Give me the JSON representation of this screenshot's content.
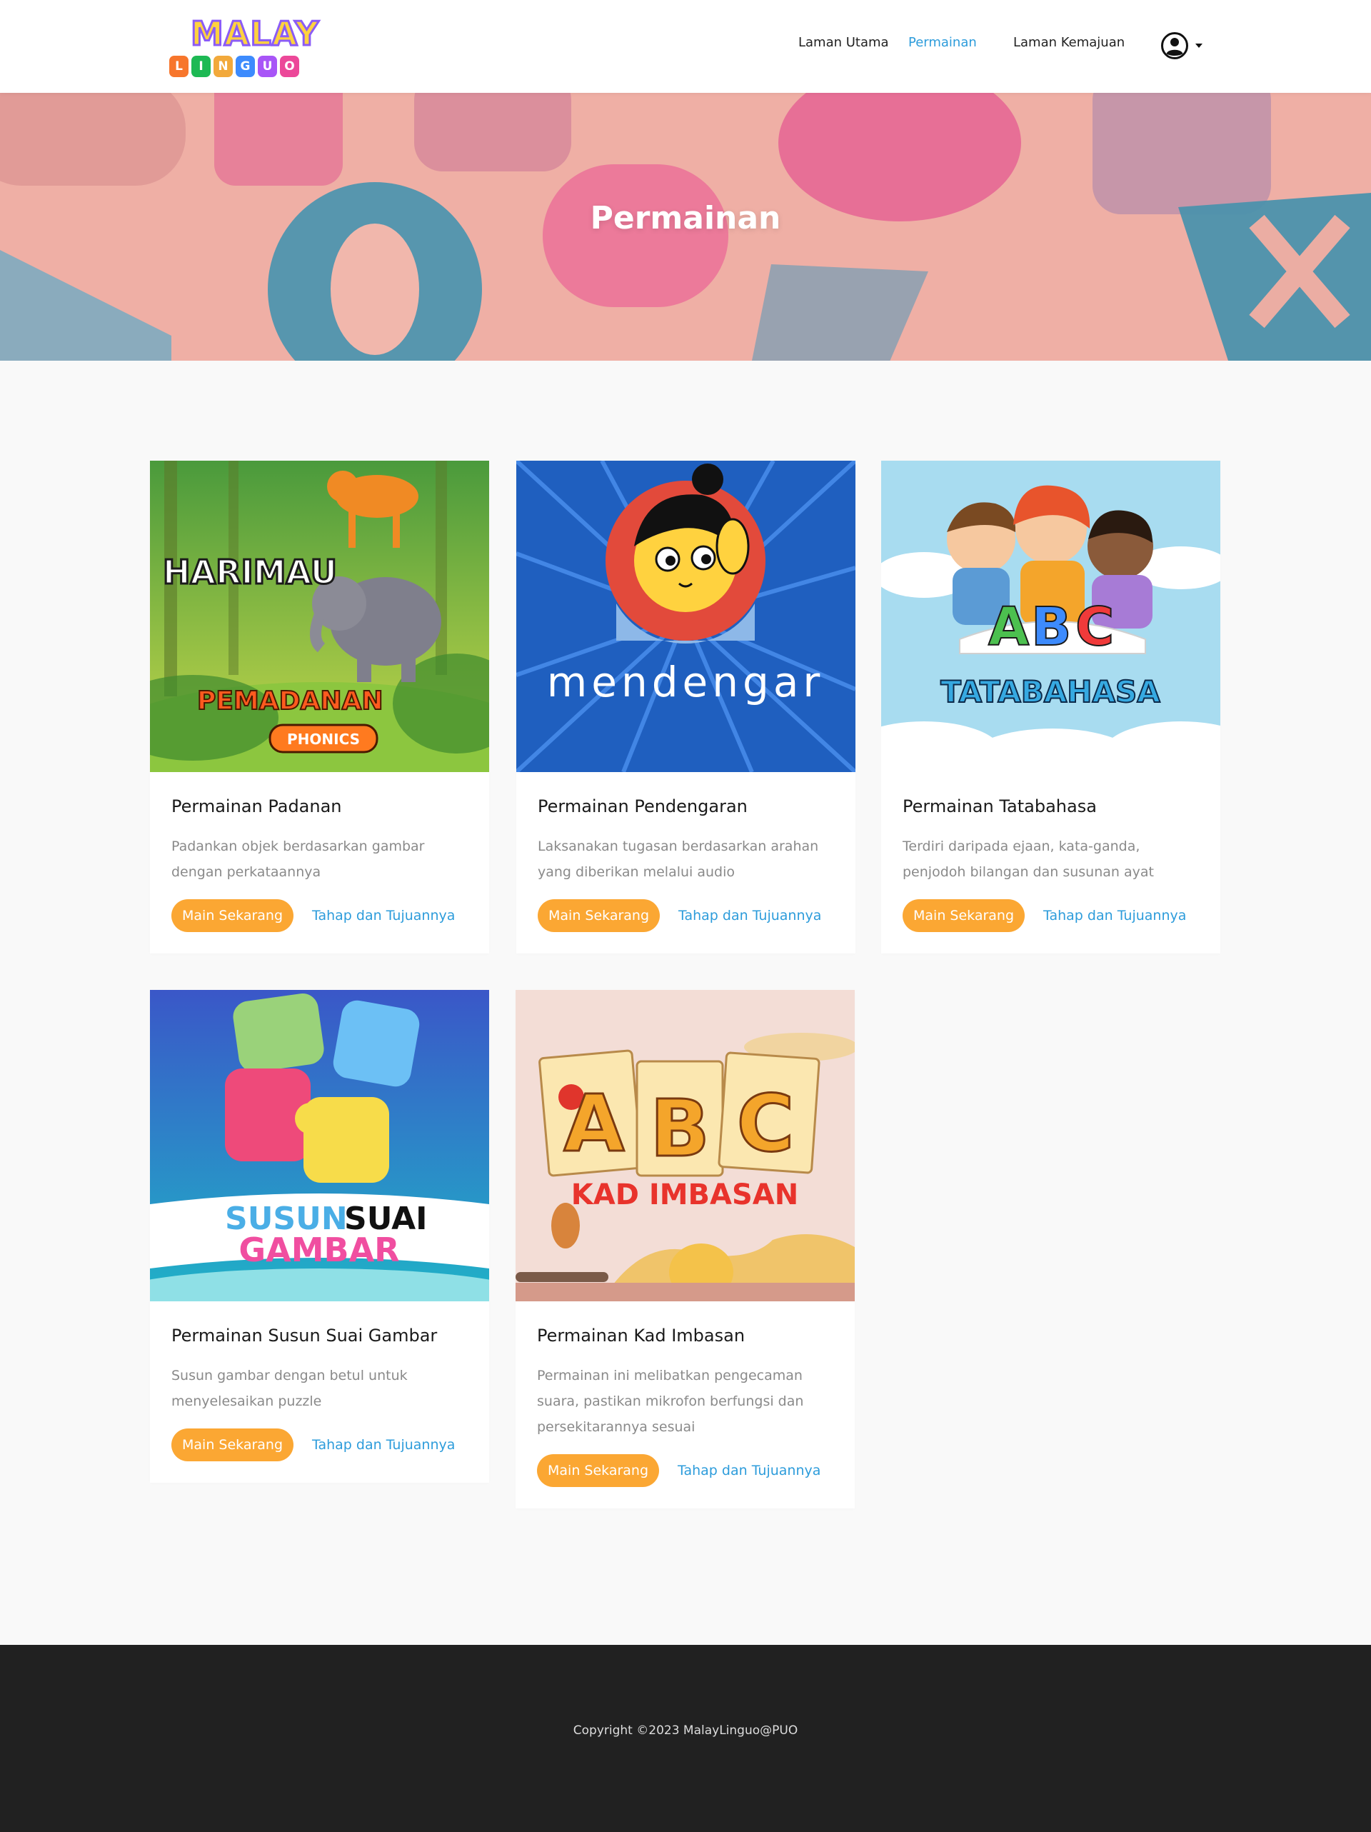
{
  "header": {
    "logo_top": "MALAY",
    "logo_letters": [
      "L",
      "I",
      "N",
      "G",
      "U",
      "O"
    ],
    "nav": [
      {
        "label": "Laman Utama",
        "active": false
      },
      {
        "label": "Permainan",
        "active": true
      },
      {
        "label": "Laman Kemajuan",
        "active": false
      }
    ],
    "user_icon": "user-circle-icon",
    "caret_icon": "caret-down-icon"
  },
  "hero": {
    "title": "Permainan"
  },
  "colors": {
    "accent_orange": "#fba733",
    "link_blue": "#2d9cdb",
    "footer_bg": "#212121",
    "page_bg": "#f9f9f9"
  },
  "cards": [
    {
      "image_text": [
        "HARIMAU",
        "PEMADANAN",
        "PHONICS"
      ],
      "title": "Permainan Padanan",
      "description": "Padankan objek berdasarkan gambar dengan perkataannya",
      "play_label": "Main Sekarang",
      "info_label": "Tahap dan Tujuannya"
    },
    {
      "image_text": [
        "mendengar"
      ],
      "title": "Permainan Pendengaran",
      "description": "Laksanakan tugasan berdasarkan arahan yang diberikan melalui audio",
      "play_label": "Main Sekarang",
      "info_label": "Tahap dan Tujuannya"
    },
    {
      "image_text": [
        "A",
        "B",
        "C",
        "TATABAHASA"
      ],
      "title": "Permainan Tatabahasa",
      "description": "Terdiri daripada ejaan, kata-ganda, penjodoh bilangan dan susunan ayat",
      "play_label": "Main Sekarang",
      "info_label": "Tahap dan Tujuannya"
    },
    {
      "image_text": [
        "SUSUN",
        "SUAI",
        "GAMBAR"
      ],
      "title": "Permainan Susun Suai Gambar",
      "description": "Susun gambar dengan betul untuk menyelesaikan puzzle",
      "play_label": "Main Sekarang",
      "info_label": "Tahap dan Tujuannya"
    },
    {
      "image_text": [
        "A",
        "B",
        "C",
        "KAD IMBASAN"
      ],
      "title": "Permainan Kad Imbasan",
      "description": "Permainan ini melibatkan pengecaman suara, pastikan mikrofon berfungsi dan persekitarannya sesuai",
      "play_label": "Main Sekarang",
      "info_label": "Tahap dan Tujuannya"
    }
  ],
  "footer": {
    "copyright": "Copyright ©2023 MalayLinguo@PUO"
  }
}
